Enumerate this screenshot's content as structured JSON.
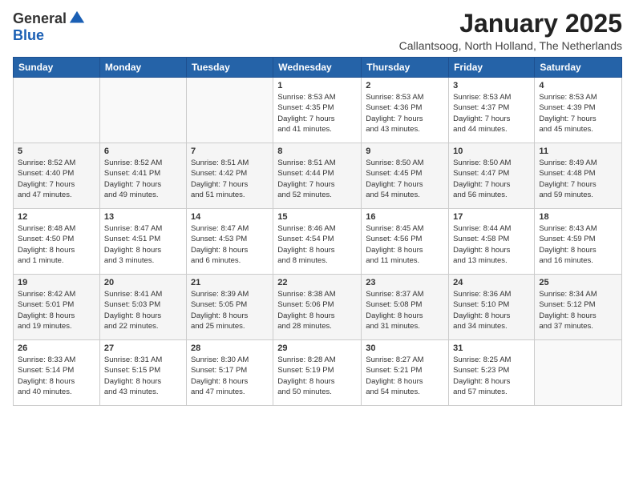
{
  "logo": {
    "general": "General",
    "blue": "Blue"
  },
  "title": "January 2025",
  "subtitle": "Callantsoog, North Holland, The Netherlands",
  "weekdays": [
    "Sunday",
    "Monday",
    "Tuesday",
    "Wednesday",
    "Thursday",
    "Friday",
    "Saturday"
  ],
  "weeks": [
    [
      {
        "day": "",
        "info": ""
      },
      {
        "day": "",
        "info": ""
      },
      {
        "day": "",
        "info": ""
      },
      {
        "day": "1",
        "info": "Sunrise: 8:53 AM\nSunset: 4:35 PM\nDaylight: 7 hours\nand 41 minutes."
      },
      {
        "day": "2",
        "info": "Sunrise: 8:53 AM\nSunset: 4:36 PM\nDaylight: 7 hours\nand 43 minutes."
      },
      {
        "day": "3",
        "info": "Sunrise: 8:53 AM\nSunset: 4:37 PM\nDaylight: 7 hours\nand 44 minutes."
      },
      {
        "day": "4",
        "info": "Sunrise: 8:53 AM\nSunset: 4:39 PM\nDaylight: 7 hours\nand 45 minutes."
      }
    ],
    [
      {
        "day": "5",
        "info": "Sunrise: 8:52 AM\nSunset: 4:40 PM\nDaylight: 7 hours\nand 47 minutes."
      },
      {
        "day": "6",
        "info": "Sunrise: 8:52 AM\nSunset: 4:41 PM\nDaylight: 7 hours\nand 49 minutes."
      },
      {
        "day": "7",
        "info": "Sunrise: 8:51 AM\nSunset: 4:42 PM\nDaylight: 7 hours\nand 51 minutes."
      },
      {
        "day": "8",
        "info": "Sunrise: 8:51 AM\nSunset: 4:44 PM\nDaylight: 7 hours\nand 52 minutes."
      },
      {
        "day": "9",
        "info": "Sunrise: 8:50 AM\nSunset: 4:45 PM\nDaylight: 7 hours\nand 54 minutes."
      },
      {
        "day": "10",
        "info": "Sunrise: 8:50 AM\nSunset: 4:47 PM\nDaylight: 7 hours\nand 56 minutes."
      },
      {
        "day": "11",
        "info": "Sunrise: 8:49 AM\nSunset: 4:48 PM\nDaylight: 7 hours\nand 59 minutes."
      }
    ],
    [
      {
        "day": "12",
        "info": "Sunrise: 8:48 AM\nSunset: 4:50 PM\nDaylight: 8 hours\nand 1 minute."
      },
      {
        "day": "13",
        "info": "Sunrise: 8:47 AM\nSunset: 4:51 PM\nDaylight: 8 hours\nand 3 minutes."
      },
      {
        "day": "14",
        "info": "Sunrise: 8:47 AM\nSunset: 4:53 PM\nDaylight: 8 hours\nand 6 minutes."
      },
      {
        "day": "15",
        "info": "Sunrise: 8:46 AM\nSunset: 4:54 PM\nDaylight: 8 hours\nand 8 minutes."
      },
      {
        "day": "16",
        "info": "Sunrise: 8:45 AM\nSunset: 4:56 PM\nDaylight: 8 hours\nand 11 minutes."
      },
      {
        "day": "17",
        "info": "Sunrise: 8:44 AM\nSunset: 4:58 PM\nDaylight: 8 hours\nand 13 minutes."
      },
      {
        "day": "18",
        "info": "Sunrise: 8:43 AM\nSunset: 4:59 PM\nDaylight: 8 hours\nand 16 minutes."
      }
    ],
    [
      {
        "day": "19",
        "info": "Sunrise: 8:42 AM\nSunset: 5:01 PM\nDaylight: 8 hours\nand 19 minutes."
      },
      {
        "day": "20",
        "info": "Sunrise: 8:41 AM\nSunset: 5:03 PM\nDaylight: 8 hours\nand 22 minutes."
      },
      {
        "day": "21",
        "info": "Sunrise: 8:39 AM\nSunset: 5:05 PM\nDaylight: 8 hours\nand 25 minutes."
      },
      {
        "day": "22",
        "info": "Sunrise: 8:38 AM\nSunset: 5:06 PM\nDaylight: 8 hours\nand 28 minutes."
      },
      {
        "day": "23",
        "info": "Sunrise: 8:37 AM\nSunset: 5:08 PM\nDaylight: 8 hours\nand 31 minutes."
      },
      {
        "day": "24",
        "info": "Sunrise: 8:36 AM\nSunset: 5:10 PM\nDaylight: 8 hours\nand 34 minutes."
      },
      {
        "day": "25",
        "info": "Sunrise: 8:34 AM\nSunset: 5:12 PM\nDaylight: 8 hours\nand 37 minutes."
      }
    ],
    [
      {
        "day": "26",
        "info": "Sunrise: 8:33 AM\nSunset: 5:14 PM\nDaylight: 8 hours\nand 40 minutes."
      },
      {
        "day": "27",
        "info": "Sunrise: 8:31 AM\nSunset: 5:15 PM\nDaylight: 8 hours\nand 43 minutes."
      },
      {
        "day": "28",
        "info": "Sunrise: 8:30 AM\nSunset: 5:17 PM\nDaylight: 8 hours\nand 47 minutes."
      },
      {
        "day": "29",
        "info": "Sunrise: 8:28 AM\nSunset: 5:19 PM\nDaylight: 8 hours\nand 50 minutes."
      },
      {
        "day": "30",
        "info": "Sunrise: 8:27 AM\nSunset: 5:21 PM\nDaylight: 8 hours\nand 54 minutes."
      },
      {
        "day": "31",
        "info": "Sunrise: 8:25 AM\nSunset: 5:23 PM\nDaylight: 8 hours\nand 57 minutes."
      },
      {
        "day": "",
        "info": ""
      }
    ]
  ]
}
